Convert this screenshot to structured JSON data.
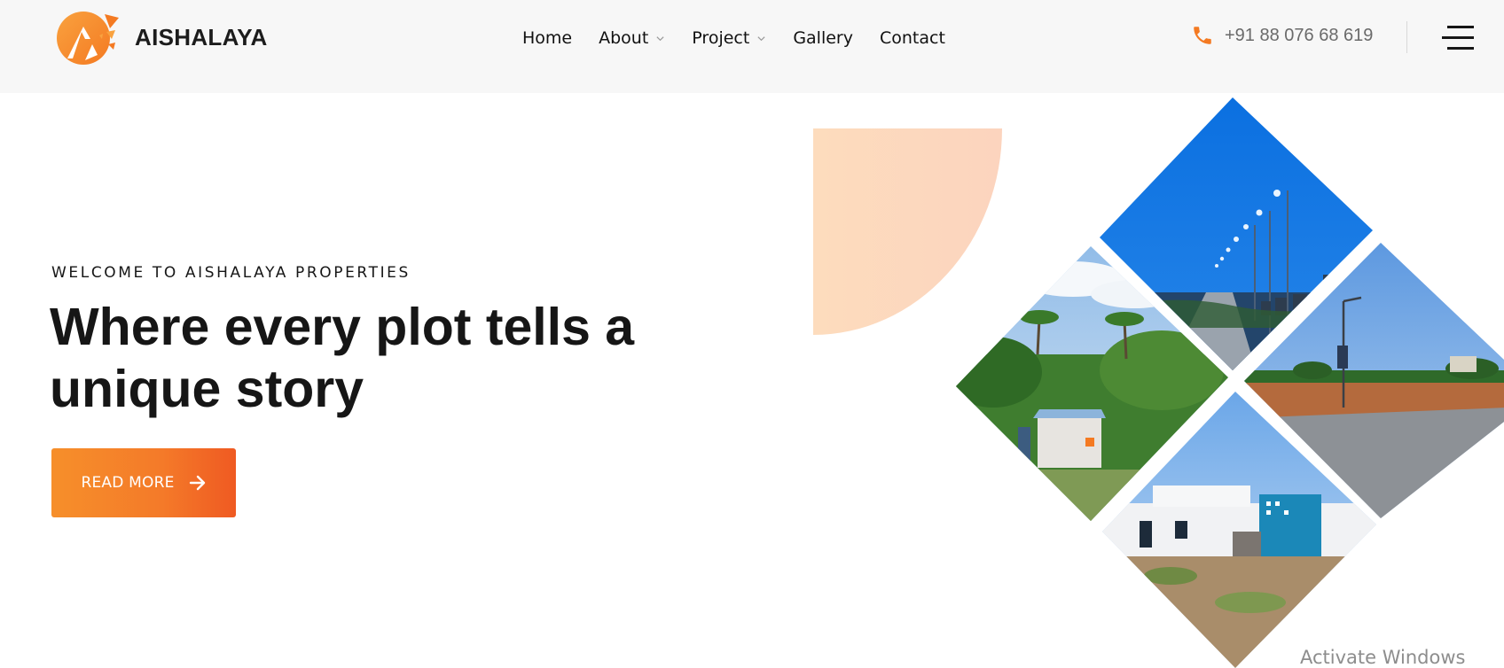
{
  "brand": {
    "name": "AISHALAYA",
    "accent": "#f68f2a"
  },
  "nav": [
    {
      "label": "Home",
      "dropdown": false
    },
    {
      "label": "About",
      "dropdown": true
    },
    {
      "label": "Project",
      "dropdown": true
    },
    {
      "label": "Gallery",
      "dropdown": false
    },
    {
      "label": "Contact",
      "dropdown": false
    }
  ],
  "contact": {
    "phone": "+91 88 076 68 619",
    "icon": "phone-icon"
  },
  "menu": {
    "icon": "hamburger-menu-icon"
  },
  "hero": {
    "eyebrow": "WELCOME TO AISHALAYA PROPERTIES",
    "headline_line1": "Where every plot tells a",
    "headline_line2": "unique story",
    "cta_label": "READ MORE",
    "cta_icon": "arrow-right-icon"
  },
  "gallery": {
    "tiles": [
      {
        "scene": "road-with-streetlights"
      },
      {
        "scene": "palm-trees-and-gatehouse"
      },
      {
        "scene": "cleared-plot-with-streetlight"
      },
      {
        "scene": "white-house-with-blue-wall"
      }
    ]
  },
  "system": {
    "watermark": "Activate Windows"
  }
}
